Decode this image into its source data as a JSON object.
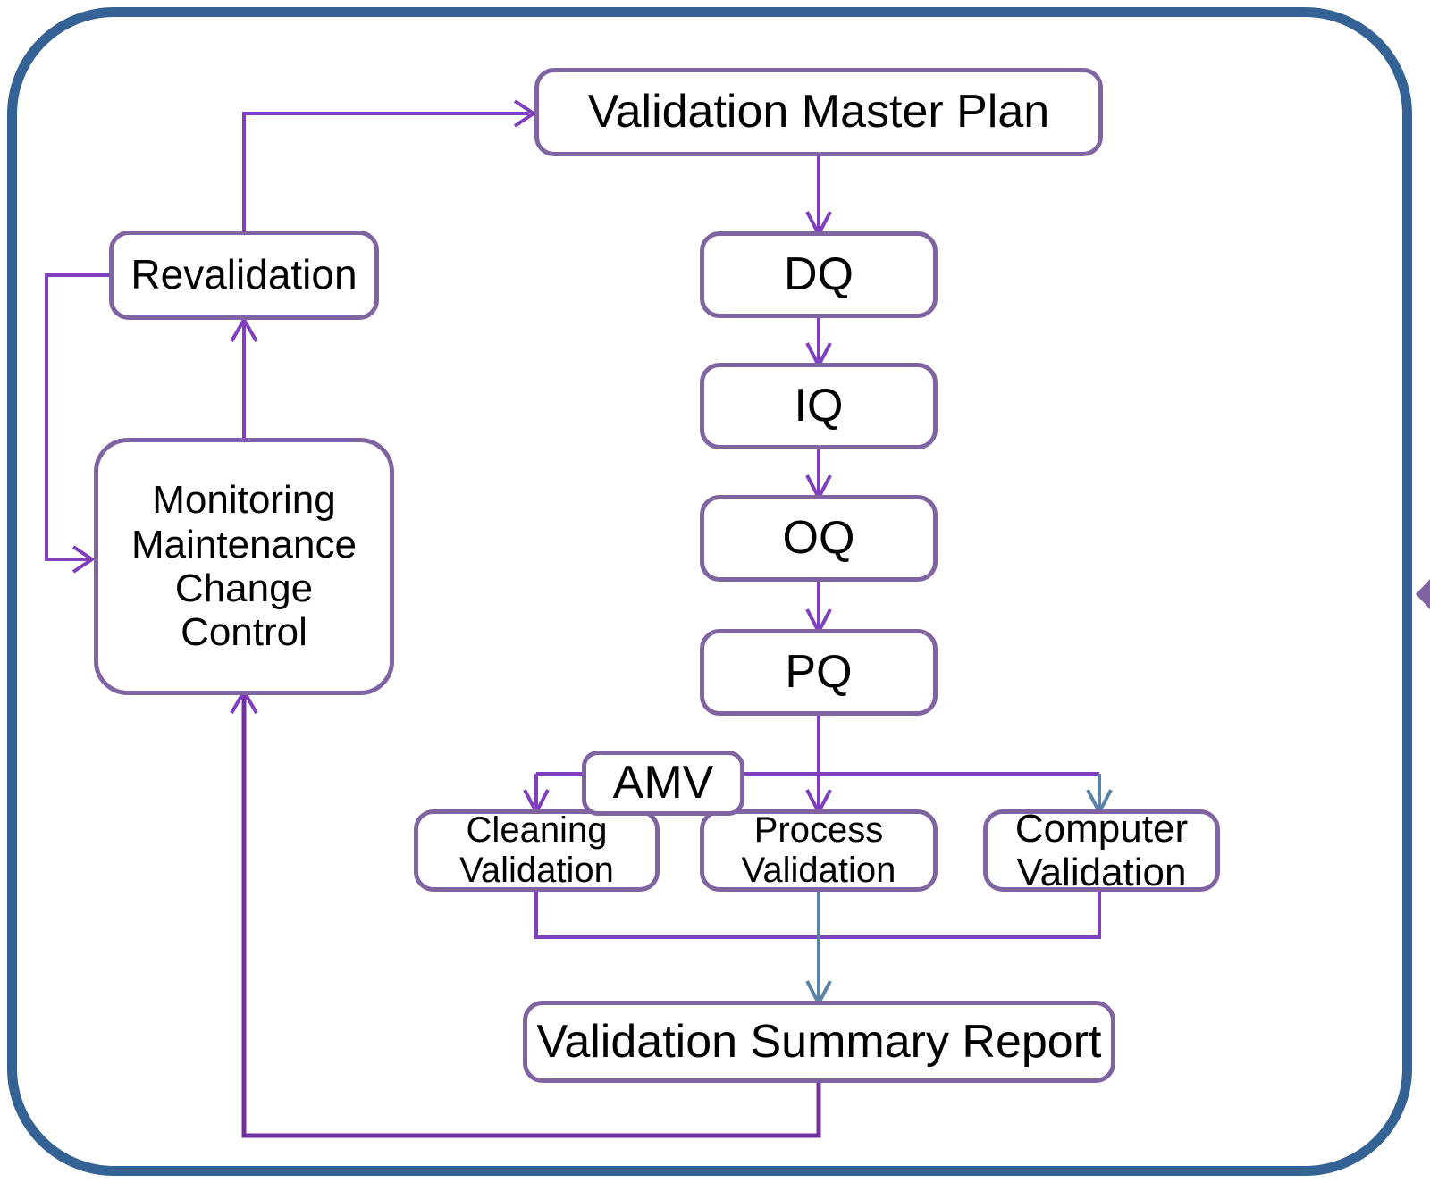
{
  "diagram": {
    "title": "Pharmaceutical Validation Lifecycle Flowchart",
    "frame_color": "#356294",
    "node_border_color": "#8064A2",
    "connector_purple": "#7F3FBF",
    "connector_blue": "#5B83A8",
    "nodes": {
      "validation_master_plan": "Validation Master Plan",
      "revalidation": "Revalidation",
      "monitoring": "Monitoring\nMaintenance\nChange\nControl",
      "dq": "DQ",
      "iq": "IQ",
      "oq": "OQ",
      "pq": "PQ",
      "amv": "AMV",
      "cleaning_validation": "Cleaning\nValidation",
      "process_validation": "Process\nValidation",
      "computer_validation": "Computer\nValidation",
      "validation_summary_report": "Validation Summary Report"
    },
    "edges": [
      {
        "from": "validation_master_plan",
        "to": "dq",
        "color": "#7F3FBF"
      },
      {
        "from": "dq",
        "to": "iq",
        "color": "#7F3FBF"
      },
      {
        "from": "iq",
        "to": "oq",
        "color": "#7F3FBF"
      },
      {
        "from": "oq",
        "to": "pq",
        "color": "#7F3FBF"
      },
      {
        "from": "pq",
        "to": "cleaning_validation",
        "color": "#7F3FBF"
      },
      {
        "from": "pq",
        "to": "process_validation",
        "color": "#7F3FBF"
      },
      {
        "from": "pq",
        "to": "computer_validation",
        "color": "#5B83A8"
      },
      {
        "from": "cleaning_validation",
        "to": "validation_summary_report",
        "color": "#7F3FBF"
      },
      {
        "from": "process_validation",
        "to": "validation_summary_report",
        "color": "#5B83A8"
      },
      {
        "from": "computer_validation",
        "to": "validation_summary_report",
        "color": "#7F3FBF"
      },
      {
        "from": "validation_summary_report",
        "to": "monitoring",
        "color": "#7F3FBF"
      },
      {
        "from": "monitoring",
        "to": "revalidation",
        "color": "#7F3FBF"
      },
      {
        "from": "revalidation",
        "to": "monitoring",
        "color": "#7F3FBF"
      },
      {
        "from": "revalidation",
        "to": "validation_master_plan",
        "color": "#7F3FBF"
      }
    ]
  }
}
